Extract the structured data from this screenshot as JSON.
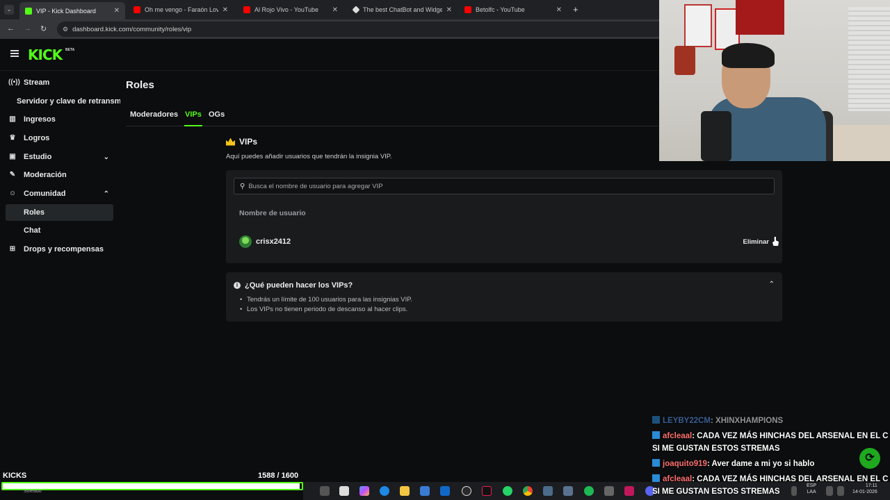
{
  "browser": {
    "tabs": [
      {
        "title": "VIP - Kick Dashboard",
        "favicon": "kick-icon",
        "active": true
      },
      {
        "title": "Oh me vengo - Faraón Love Sh",
        "favicon": "youtube-icon",
        "active": false
      },
      {
        "title": "Al Rojo Vivo - YouTube",
        "favicon": "youtube-icon",
        "active": false
      },
      {
        "title": "The best ChatBot and Widgets",
        "favicon": "chatbot-icon",
        "active": false
      },
      {
        "title": "Betolfc - YouTube",
        "favicon": "youtube-icon",
        "active": false
      }
    ],
    "url": "dashboard.kick.com/community/roles/vip"
  },
  "header": {
    "logo": "KICK",
    "badge": "BETA"
  },
  "sidebar": {
    "items": [
      {
        "label": "Stream",
        "icon": "broadcast-icon"
      },
      {
        "label": "Servidor y clave de retransm",
        "icon": ""
      },
      {
        "label": "Ingresos",
        "icon": "chart-icon"
      },
      {
        "label": "Logros",
        "icon": "trophy-icon"
      },
      {
        "label": "Estudio",
        "icon": "studio-icon",
        "chevron": "down"
      },
      {
        "label": "Moderación",
        "icon": "wrench-icon"
      },
      {
        "label": "Comunidad",
        "icon": "community-icon",
        "chevron": "up"
      },
      {
        "label": "Roles",
        "icon": "",
        "selected": true
      },
      {
        "label": "Chat",
        "icon": ""
      },
      {
        "label": "Drops y recompensas",
        "icon": "gift-icon"
      }
    ]
  },
  "main": {
    "title": "Roles",
    "tabs": [
      {
        "label": "Moderadores"
      },
      {
        "label": "VIPs",
        "active": true
      },
      {
        "label": "OGs"
      }
    ],
    "vip_section": {
      "heading": "VIPs",
      "description": "Aquí puedes añadir usuarios que tendrán la insignia VIP.",
      "search_placeholder": "Busca el nombre de usuario para agregar VIP",
      "column_header": "Nombre de usuario",
      "users": [
        {
          "username": "crisx2412",
          "action": "Eliminar"
        }
      ]
    },
    "faq": {
      "title": "¿Qué pueden hacer los VIPs?",
      "items": [
        "Tendrás un límite de 100 usuarios para las insignias VIP.",
        "Los VIPs no tienen periodo de descanso al hacer clips."
      ]
    }
  },
  "overlay": {
    "kicks_label": "KICKS",
    "kicks_count": "1588 / 1600",
    "kicks_progress": 0.9925,
    "chat": [
      {
        "user": "LEYBY22CM",
        "message": ": XHINXHAMPIONS",
        "faded": true
      },
      {
        "user": "afcleaal",
        "message": ": CADA VEZ MÁS HINCHAS DEL ARSENAL EN EL C"
      },
      {
        "user": "",
        "message": "SI ME GUSTAN ESTOS STREMAS"
      },
      {
        "user": "joaquito919",
        "message": ": Aver dame a mi yo si hablo"
      },
      {
        "user": "afcleaal",
        "message": ": CADA VEZ MÁS HINCHAS DEL ARSENAL EN EL C"
      },
      {
        "user": "",
        "message": "SI ME GUSTAN ESTOS STREMAS"
      }
    ]
  },
  "taskbar": {
    "weather": "Soleado",
    "lang_top": "ESP",
    "lang_bottom": "LAA",
    "time": "17:11",
    "date": "14-01-2026"
  },
  "colors": {
    "accent": "#53fc18",
    "background": "#0b0d0e",
    "panel": "#191b1d"
  }
}
